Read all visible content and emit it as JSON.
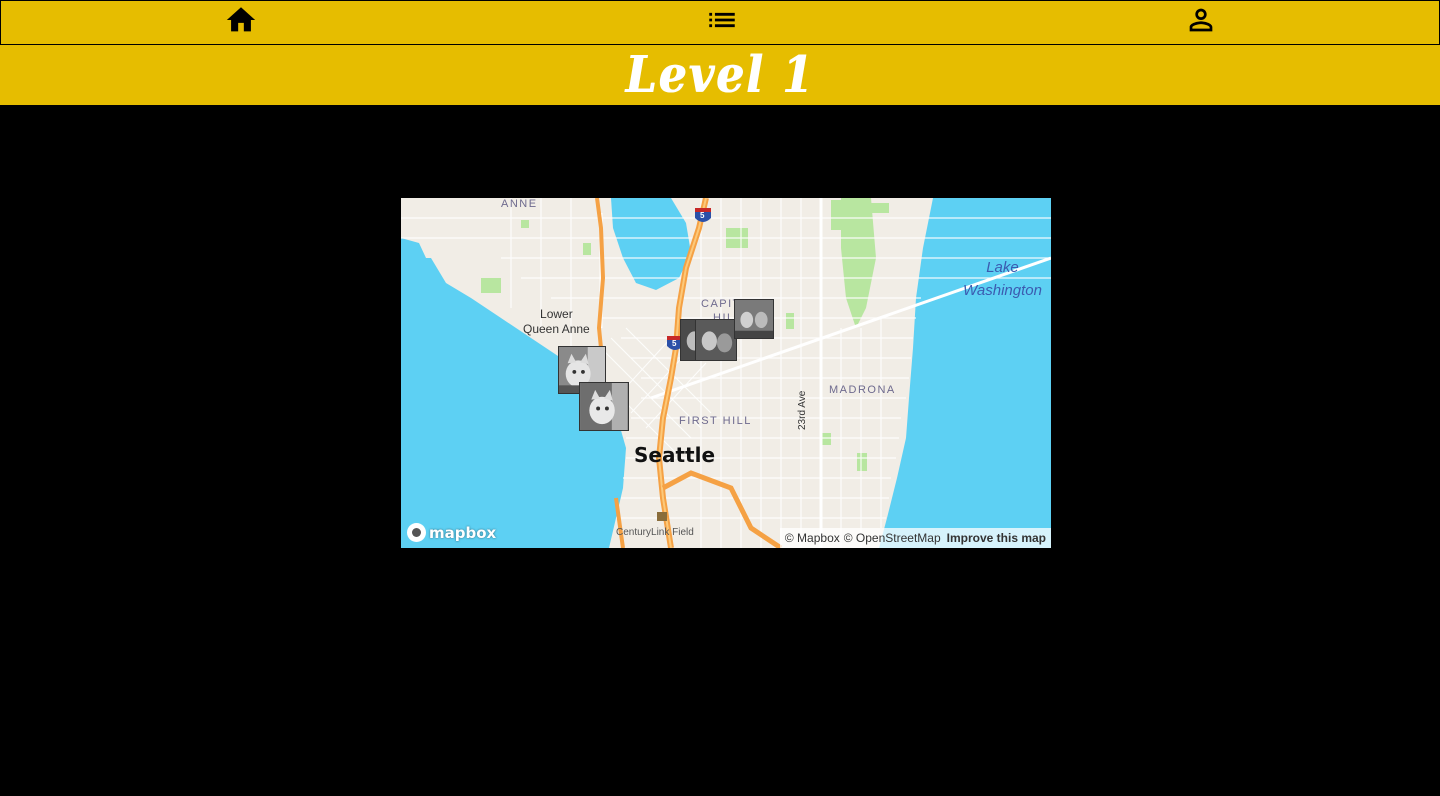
{
  "nav": {
    "icons": [
      "home-icon",
      "list-icon",
      "person-icon"
    ]
  },
  "level": {
    "title": "Level 1"
  },
  "map": {
    "labels": {
      "anne": "ANNE",
      "lower_queen_anne_1": "Lower",
      "lower_queen_anne_2": "Queen Anne",
      "capitol_hill_1": "CAPIT",
      "capitol_hill_2": "HILL",
      "madrona": "MADRONA",
      "first_hill": "FIRST HILL",
      "seattle": "Seattle",
      "lake_1": "Lake",
      "lake_2": "Washington",
      "road_23rd": "23rd Ave",
      "centurylink": "CenturyLink Field",
      "i5_top": "5",
      "i5_mid": "5"
    },
    "logo_text": "mapbox",
    "attribution": {
      "mapbox": "© Mapbox",
      "osm": "© OpenStreetMap",
      "improve": "Improve this map"
    },
    "colors": {
      "water": "#5dd0f3",
      "land": "#f1ede6",
      "park": "#b8e6a0",
      "highway": "#f5a144"
    }
  }
}
